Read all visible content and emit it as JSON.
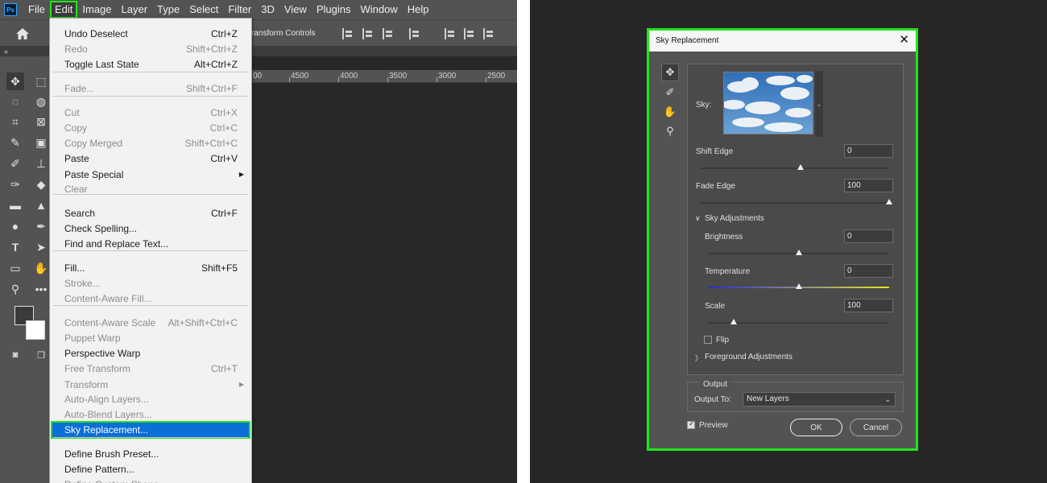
{
  "app": {
    "logo": "Ps",
    "menu": [
      "File",
      "Edit",
      "Image",
      "Layer",
      "Type",
      "Select",
      "Filter",
      "3D",
      "View",
      "Plugins",
      "Window",
      "Help"
    ],
    "active_menu": "Edit"
  },
  "options_bar": {
    "transform_controls": "ransform Controls"
  },
  "panel_strip": "«",
  "ruler": [
    "00",
    "4500",
    "4000",
    "3500",
    "3000",
    "2500"
  ],
  "toolbar_icons": [
    "move-icon",
    "marquee-icon",
    "lasso-icon",
    "object-select-icon",
    "crop-icon",
    "frame-icon",
    "eyedropper-icon",
    "patch-icon",
    "brush-icon",
    "stamp-icon",
    "history-brush-icon",
    "eraser-icon",
    "gradient-icon",
    "blur-icon",
    "dodge-icon",
    "pen-icon",
    "type-icon",
    "path-select-icon",
    "rectangle-icon",
    "hand-icon",
    "zoom-icon",
    "more-icon"
  ],
  "edit_menu": {
    "items": [
      {
        "label": "Undo Deselect",
        "shortcut": "Ctrl+Z",
        "disabled": false
      },
      {
        "label": "Redo",
        "shortcut": "Shift+Ctrl+Z",
        "disabled": true
      },
      {
        "label": "Toggle Last State",
        "shortcut": "Alt+Ctrl+Z",
        "disabled": false
      },
      {
        "label": "Fade...",
        "shortcut": "Shift+Ctrl+F",
        "disabled": true
      },
      {
        "label": "Cut",
        "shortcut": "Ctrl+X",
        "disabled": true
      },
      {
        "label": "Copy",
        "shortcut": "Ctrl+C",
        "disabled": true
      },
      {
        "label": "Copy Merged",
        "shortcut": "Shift+Ctrl+C",
        "disabled": true
      },
      {
        "label": "Paste",
        "shortcut": "Ctrl+V",
        "disabled": false
      },
      {
        "label": "Paste Special",
        "shortcut": "",
        "disabled": false,
        "submenu": true
      },
      {
        "label": "Clear",
        "shortcut": "",
        "disabled": true
      },
      {
        "label": "Search",
        "shortcut": "Ctrl+F",
        "disabled": false
      },
      {
        "label": "Check Spelling...",
        "shortcut": "",
        "disabled": false
      },
      {
        "label": "Find and Replace Text...",
        "shortcut": "",
        "disabled": false
      },
      {
        "label": "Fill...",
        "shortcut": "Shift+F5",
        "disabled": false
      },
      {
        "label": "Stroke...",
        "shortcut": "",
        "disabled": true
      },
      {
        "label": "Content-Aware Fill...",
        "shortcut": "",
        "disabled": true
      },
      {
        "label": "Content-Aware Scale",
        "shortcut": "Alt+Shift+Ctrl+C",
        "disabled": true
      },
      {
        "label": "Puppet Warp",
        "shortcut": "",
        "disabled": true
      },
      {
        "label": "Perspective Warp",
        "shortcut": "",
        "disabled": false
      },
      {
        "label": "Free Transform",
        "shortcut": "Ctrl+T",
        "disabled": true
      },
      {
        "label": "Transform",
        "shortcut": "",
        "disabled": true,
        "submenu": true
      },
      {
        "label": "Auto-Align Layers...",
        "shortcut": "",
        "disabled": true
      },
      {
        "label": "Auto-Blend Layers...",
        "shortcut": "",
        "disabled": true
      },
      {
        "label": "Sky Replacement...",
        "shortcut": "",
        "disabled": false,
        "highlighted": true
      },
      {
        "label": "Define Brush Preset...",
        "shortcut": "",
        "disabled": false
      },
      {
        "label": "Define Pattern...",
        "shortcut": "",
        "disabled": false
      },
      {
        "label": "Define Custom Shape...",
        "shortcut": "",
        "disabled": true
      }
    ]
  },
  "dialog": {
    "title": "Sky Replacement",
    "close": "✕",
    "tools": [
      "move-sky-icon",
      "sky-brush-icon",
      "hand-icon",
      "zoom-icon"
    ],
    "sky_label": "Sky:",
    "shift_edge": {
      "label": "Shift Edge",
      "value": "0",
      "level": 0.53
    },
    "fade_edge": {
      "label": "Fade Edge",
      "value": "100",
      "level": 1.0
    },
    "sky_adjustments": "Sky Adjustments",
    "brightness": {
      "label": "Brightness",
      "value": "0",
      "level": 0.5
    },
    "temperature": {
      "label": "Temperature",
      "value": "0",
      "level": 0.5
    },
    "scale": {
      "label": "Scale",
      "value": "100",
      "level": 0.14
    },
    "flip": {
      "label": "Flip",
      "checked": false
    },
    "foreground_adjustments": "Foreground Adjustments",
    "output": {
      "heading": "Output",
      "label": "Output To:",
      "value": "New Layers"
    },
    "preview": {
      "label": "Preview",
      "checked": true
    },
    "ok": "OK",
    "cancel": "Cancel"
  },
  "colors": {
    "highlight_outline": "#22e51c",
    "selection": "#0a6fd6",
    "temperature_cold": "#2b2bd6",
    "temperature_warm": "#e6e61e"
  }
}
